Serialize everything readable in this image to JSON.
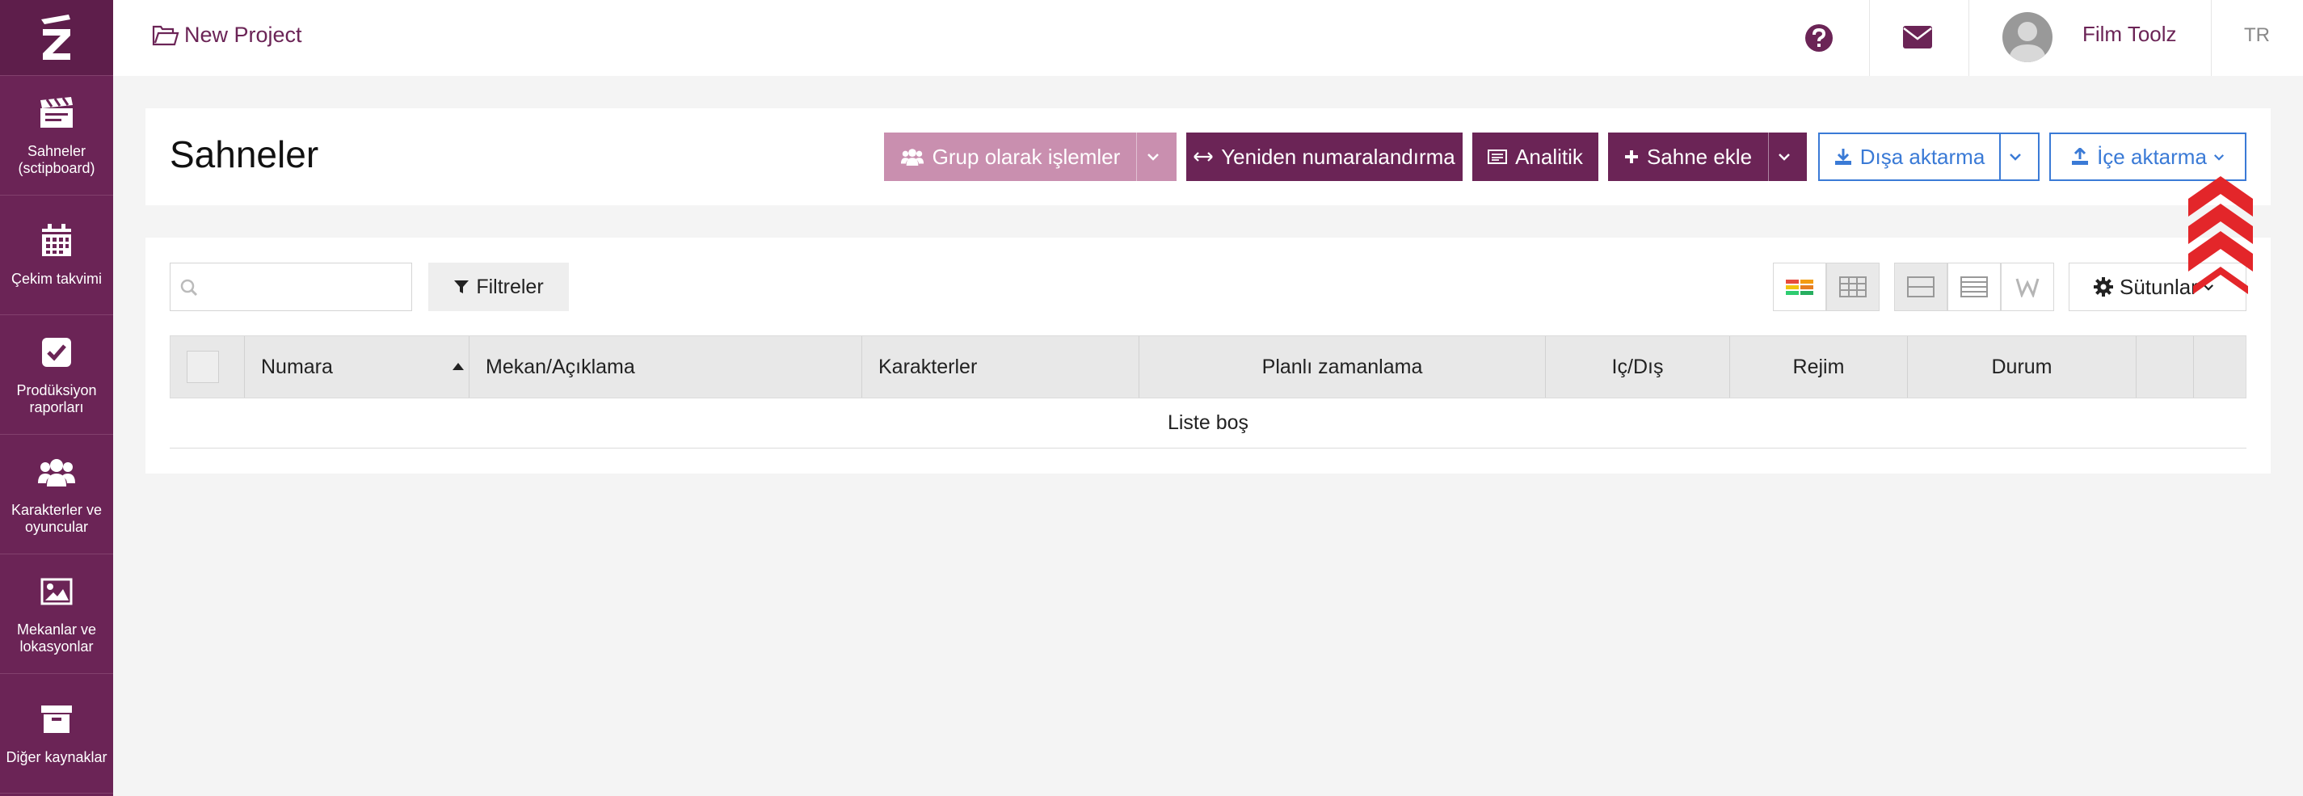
{
  "sidebar": {
    "items": [
      {
        "label": "Sahneler (sctipboard)",
        "icon": "clapperboard-icon"
      },
      {
        "label": "Çekim takvimi",
        "icon": "calendar-icon"
      },
      {
        "label": "Prodüksiyon raporları",
        "icon": "checkbox-icon"
      },
      {
        "label": "Karakterler ve oyuncular",
        "icon": "users-icon"
      },
      {
        "label": "Mekanlar ve lokasyonlar",
        "icon": "image-icon"
      },
      {
        "label": "Diğer kaynaklar",
        "icon": "archive-icon"
      }
    ]
  },
  "topbar": {
    "project_name": "New Project",
    "user_name": "Film Toolz",
    "language": "TR"
  },
  "header": {
    "title": "Sahneler",
    "group_actions_label": "Grup olarak işlemler",
    "renumber_label": "Yeniden numaralandırma",
    "analytics_label": "Analitik",
    "add_scene_label": "Sahne ekle",
    "export_label": "Dışa aktarma",
    "import_label": "İçe aktarma"
  },
  "table": {
    "search_placeholder": "",
    "filters_label": "Filtreler",
    "columns_label": "Sütunlar",
    "columns": [
      "Numara",
      "Mekan/Açıklama",
      "Karakterler",
      "Planlı zamanlama",
      "Iç/Dış",
      "Rejim",
      "Durum"
    ],
    "empty_text": "Liste boş"
  },
  "colors": {
    "brand": "#6b2456",
    "brand_light": "#c98faf",
    "link_blue": "#3a7ad6",
    "indicator_red": "#e3262a"
  }
}
